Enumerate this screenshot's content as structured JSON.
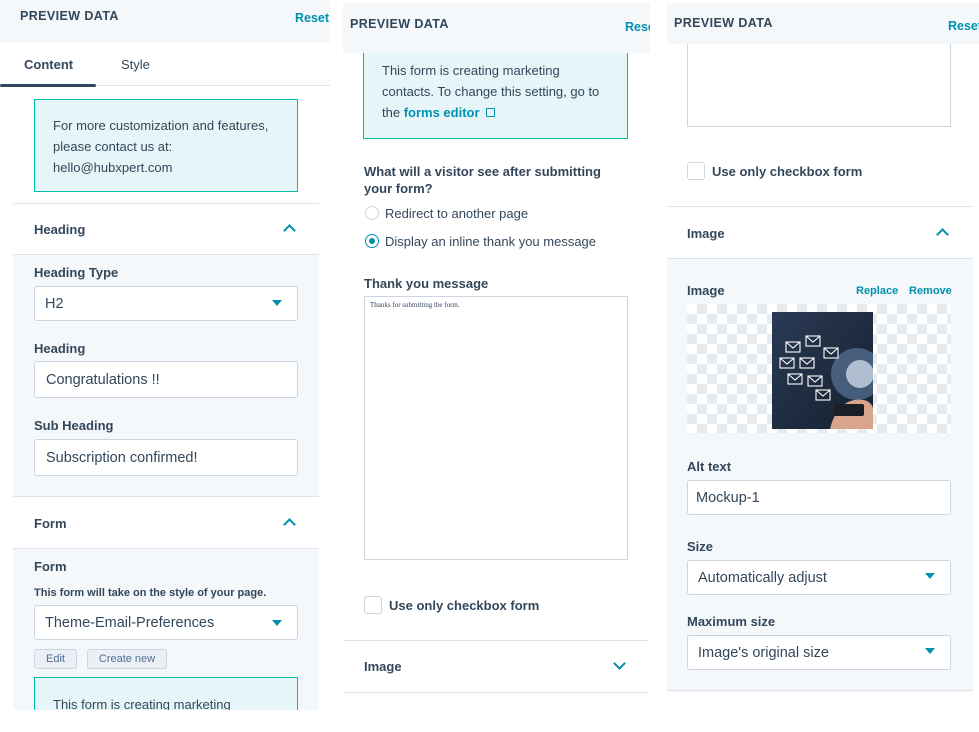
{
  "panel1": {
    "title": "PREVIEW DATA",
    "reset": "Reset",
    "tabs": [
      "Content",
      "Style"
    ],
    "info_lines": [
      "For more customization and features,",
      "please contact us at:",
      "hello@hubxpert.com"
    ],
    "heading_section": "Heading",
    "heading_type_label": "Heading Type",
    "heading_type_value": "H2",
    "heading_label": "Heading",
    "heading_value": "Congratulations !!",
    "subheading_label": "Sub Heading",
    "subheading_value": "Subscription confirmed!",
    "form_section": "Form",
    "form_label": "Form",
    "form_help": "This form will take on the style of your page.",
    "form_value": "Theme-Email-Preferences",
    "edit_button": "Edit",
    "create_button": "Create new",
    "marketing_partial": "This form is creating marketing"
  },
  "panel2": {
    "title": "PREVIEW DATA",
    "reset": "Rese",
    "info_lines": [
      "This form is creating marketing",
      "contacts. To change this setting, go to"
    ],
    "info_prefix": "the",
    "forms_editor_link": "forms editor",
    "question_lines": [
      "What will a visitor see after submitting",
      "your form?"
    ],
    "option_redirect": "Redirect to another page",
    "option_inline": "Display an inline thank you message",
    "thank_label": "Thank you message",
    "thank_value": "Thanks for submitting the form.",
    "checkbox_label": "Use only checkbox form",
    "image_section": "Image"
  },
  "panel3": {
    "title": "PREVIEW DATA",
    "reset": "Reset",
    "checkbox_label": "Use only checkbox form",
    "image_section": "Image",
    "image_label": "Image",
    "replace": "Replace",
    "remove": "Remove",
    "alt_label": "Alt text",
    "alt_value": "Mockup-1",
    "size_label": "Size",
    "size_value": "Automatically adjust",
    "max_label": "Maximum size",
    "max_value": "Image's original size"
  },
  "colors": {
    "accent": "#0091ae",
    "info_bg": "#e5f5f8",
    "info_border": "#00bda5",
    "text": "#33475b",
    "section_bg": "#f5f8fa"
  }
}
